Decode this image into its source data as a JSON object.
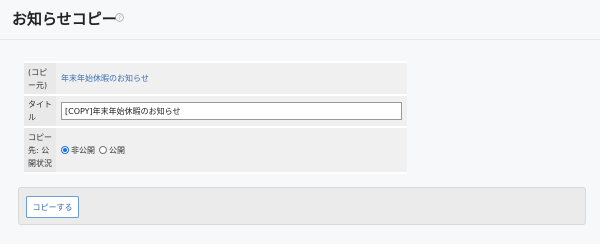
{
  "page": {
    "title": "お知らせコピー"
  },
  "form": {
    "source": {
      "label": "(コピー元)",
      "value": "年末年始休暇のお知らせ"
    },
    "title": {
      "label": "タイトル",
      "value": "[COPY]年末年始休暇のお知らせ"
    },
    "status": {
      "label": "コピー先: 公開状況",
      "options": [
        {
          "label": "非公開",
          "checked": true
        },
        {
          "label": "公開",
          "checked": false
        }
      ]
    }
  },
  "actions": {
    "copy_label": "コピーする"
  },
  "colors": {
    "accent": "#1a73e8",
    "link": "#3b6fb6",
    "button_text": "#2f6fb8"
  },
  "icons": {
    "help": "help-circle-icon"
  }
}
